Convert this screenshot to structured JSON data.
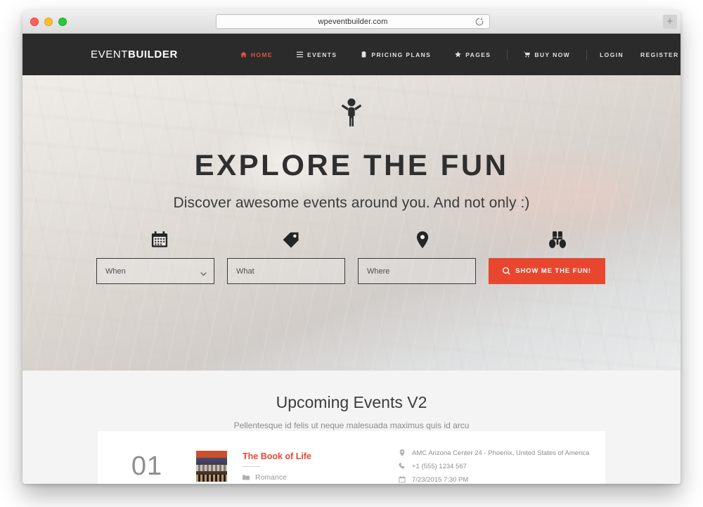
{
  "browser": {
    "url": "wpeventbuilder.com",
    "reload_icon": "reload-icon",
    "new_tab_label": "+",
    "traffic_lights": [
      "close",
      "minimize",
      "maximize"
    ]
  },
  "nav": {
    "brand_thin": "EVENT",
    "brand_bold": "BUILDER",
    "items": [
      {
        "label": "HOME",
        "icon": "home-icon",
        "active": true
      },
      {
        "label": "EVENTS",
        "icon": "list-icon",
        "active": false
      },
      {
        "label": "PRICING PLANS",
        "icon": "clipboard-icon",
        "active": false
      },
      {
        "label": "PAGES",
        "icon": "star-icon",
        "active": false
      },
      {
        "label": "BUY NOW",
        "icon": "cart-icon",
        "active": false
      }
    ],
    "account": [
      {
        "label": "LOGIN"
      },
      {
        "label": "REGISTER"
      }
    ],
    "menu_toggle_icon": "hamburger-icon"
  },
  "hero": {
    "person_icon": "person-raised-arms-icon",
    "title": "EXPLORE THE FUN",
    "subtitle": "Discover awesome events around you. And not only :)",
    "search": {
      "icons": [
        "calendar-icon",
        "tag-icon",
        "map-pin-icon",
        "binoculars-icon"
      ],
      "fields": [
        {
          "name": "when",
          "placeholder": "When",
          "value": "",
          "has_dropdown": true
        },
        {
          "name": "what",
          "placeholder": "What",
          "value": "",
          "has_dropdown": false
        },
        {
          "name": "where",
          "placeholder": "Where",
          "value": "",
          "has_dropdown": false
        }
      ],
      "submit_label": "SHOW ME THE FUN!",
      "submit_icon": "search-icon",
      "submit_color": "#e8462e"
    }
  },
  "events": {
    "heading": "Upcoming Events V2",
    "subheading": "Pellentesque id felis ut neque malesuada maximus quis id arcu",
    "list": [
      {
        "number": "01",
        "title": "The Book of Life",
        "category": "Romance",
        "category_icon": "folder-icon",
        "location": "AMC Arizona Center 24 - Phoenix, United States of America",
        "location_icon": "map-pin-icon",
        "phone": "+1 (555) 1234 567",
        "phone_icon": "phone-icon",
        "datetime": "7/23/2015 7:30 PM",
        "datetime_icon": "calendar-icon"
      }
    ]
  },
  "theme": {
    "accent": "#e8462e",
    "nav_background": "#2b2b2b",
    "section_background": "#f4f4f4"
  }
}
